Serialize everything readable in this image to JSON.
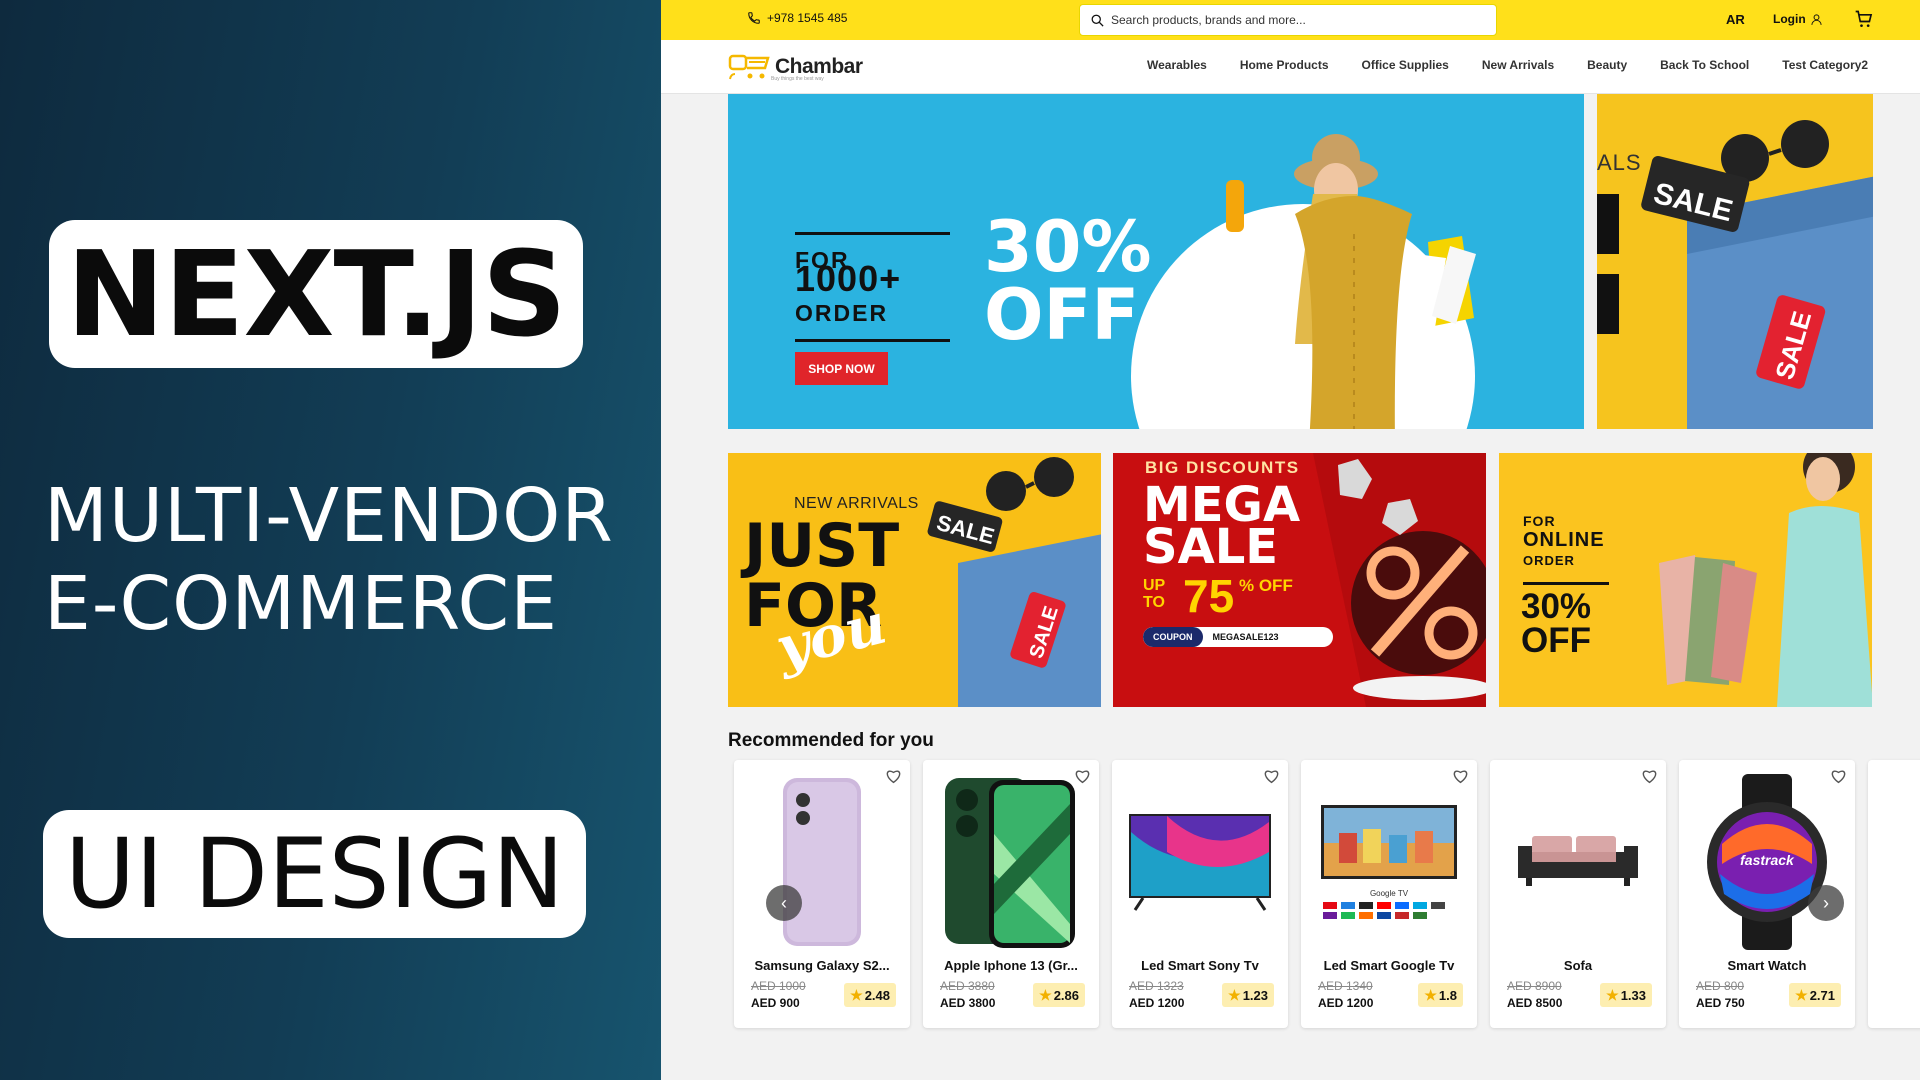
{
  "thumbnail": {
    "title": "NEXT.JS",
    "subtitle_line1": "MULTI-VENDOR",
    "subtitle_line2": "E-COMMERCE",
    "tag": "UI DESIGN"
  },
  "topbar": {
    "phone": "+978 1545 485",
    "search_placeholder": "Search products, brands and more...",
    "language": "AR",
    "login": "Login"
  },
  "navbar": {
    "logo": "Chambar",
    "logo_tagline": "Buy things the best way",
    "categories": [
      "Wearables",
      "Home Products",
      "Office Supplies",
      "New Arrivals",
      "Beauty",
      "Back To School",
      "Test Category2"
    ]
  },
  "hero": {
    "for": "FOR",
    "count": "1000+",
    "order": "ORDER",
    "discount_1": "30%",
    "discount_2": "OFF",
    "cta": "SHOP NOW",
    "side_text_1": "ALS",
    "side_tag": "SALE",
    "side_tag_2": "SALE"
  },
  "promo_banners": [
    {
      "kicker": "NEW ARRIVALS",
      "line1": "JUST",
      "line2": "FOR",
      "script": "you",
      "tag": "SALE",
      "tag2": "SALE"
    },
    {
      "kicker": "BIG DISCOUNTS",
      "line1": "MEGA",
      "line2": "SALE",
      "upto": "UP TO",
      "percent": "75",
      "off": "% OFF",
      "coupon_label": "COUPON",
      "coupon_code": "MEGASALE123"
    },
    {
      "for": "FOR",
      "line1": "ONLINE",
      "line2": "ORDER",
      "discount_1": "30%",
      "discount_2": "OFF"
    }
  ],
  "recommended": {
    "title": "Recommended for you",
    "products": [
      {
        "name": "Samsung Galaxy S2...",
        "old_price": "AED 1000",
        "price": "AED 900",
        "rating": "2.48"
      },
      {
        "name": "Apple Iphone 13 (Gr...",
        "old_price": "AED 3880",
        "price": "AED 3800",
        "rating": "2.86"
      },
      {
        "name": "Led Smart Sony Tv",
        "old_price": "AED 1323",
        "price": "AED 1200",
        "rating": "1.23"
      },
      {
        "name": "Led Smart Google Tv",
        "old_price": "AED 1340",
        "price": "AED 1200",
        "rating": "1.8"
      },
      {
        "name": "Sofa",
        "old_price": "AED 8900",
        "price": "AED 8500",
        "rating": "1.33"
      },
      {
        "name": "Smart Watch",
        "old_price": "AED 800",
        "price": "AED 750",
        "rating": "2.71"
      }
    ],
    "tv_brand": "Google TV",
    "watch_brand": "fastrack"
  },
  "colors": {
    "accent_yellow": "#ffe01a",
    "promo_red": "#d10f10",
    "hero_blue": "#2bb3e0",
    "cta_red": "#e0252a"
  }
}
